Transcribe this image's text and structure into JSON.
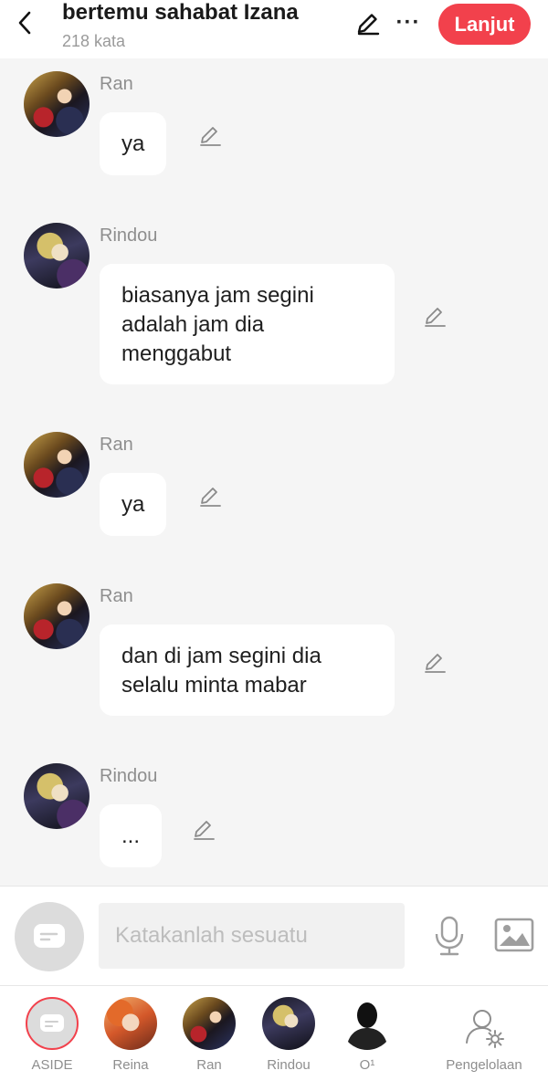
{
  "header": {
    "title": "bertemu sahabat Izana",
    "word_count": "218 kata",
    "more_label": "···",
    "next_label": "Lanjut",
    "accent_color": "#f2414c"
  },
  "messages": [
    {
      "speaker": "Ran",
      "text": "ya",
      "avatar": "ran-avatar"
    },
    {
      "speaker": "Rindou",
      "text": "biasanya jam segini\nadalah jam dia\nmenggabut",
      "avatar": "rindou-avatar"
    },
    {
      "speaker": "Ran",
      "text": "ya",
      "avatar": "ran-avatar"
    },
    {
      "speaker": "Ran",
      "text": "dan di jam segini dia\nselalu minta mabar",
      "avatar": "ran-avatar"
    },
    {
      "speaker": "Rindou",
      "text": "...",
      "avatar": "rindou-avatar"
    }
  ],
  "input": {
    "placeholder": "Katakanlah sesuatu"
  },
  "characters": [
    {
      "name": "ASIDE",
      "icon": "aside-icon",
      "selected": true
    },
    {
      "name": "Reina",
      "icon": "reina-avatar"
    },
    {
      "name": "Ran",
      "icon": "ran-avatar"
    },
    {
      "name": "Rindou",
      "icon": "rindou-avatar"
    },
    {
      "name": "O¹",
      "icon": "person-silhouette-icon"
    }
  ],
  "manage": {
    "label": "Pengelolaan",
    "icon": "user-settings-icon"
  }
}
